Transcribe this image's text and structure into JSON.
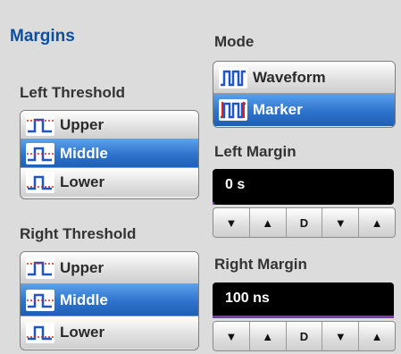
{
  "panel": {
    "title": "Margins"
  },
  "left_threshold": {
    "label": "Left Threshold",
    "options": [
      "Upper",
      "Middle",
      "Lower"
    ],
    "selected": "Middle"
  },
  "right_threshold": {
    "label": "Right Threshold",
    "options": [
      "Upper",
      "Middle",
      "Lower"
    ],
    "selected": "Middle"
  },
  "mode": {
    "label": "Mode",
    "options": [
      "Waveform",
      "Marker"
    ],
    "selected": "Marker"
  },
  "left_margin": {
    "label": "Left Margin",
    "value": "0 s",
    "steps": [
      "▼",
      "▲",
      "D",
      "▼",
      "▲"
    ]
  },
  "right_margin": {
    "label": "Right Margin",
    "value": "100 ns",
    "steps": [
      "▼",
      "▲",
      "D",
      "▼",
      "▲"
    ]
  },
  "colors": {
    "title_blue": "#0e4f9c",
    "selected_blue": "#2e73cc",
    "field_bg": "#000000",
    "field_bar": "#7a3bb5"
  }
}
